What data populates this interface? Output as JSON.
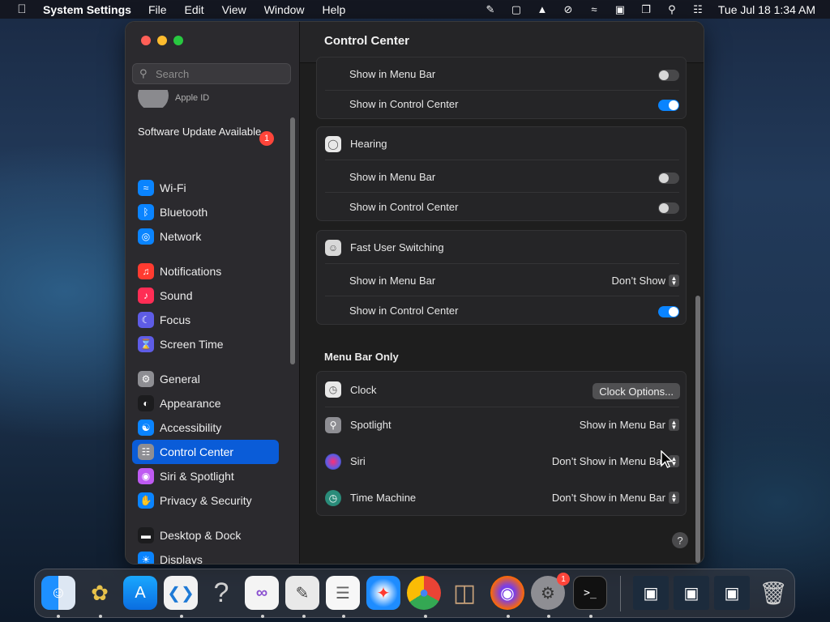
{
  "menubar": {
    "app_name": "System Settings",
    "items": [
      "File",
      "Edit",
      "View",
      "Window",
      "Help"
    ],
    "clock": "Tue Jul 18  1:34 AM"
  },
  "sidebar": {
    "search_placeholder": "Search",
    "apple_id_label": "Apple ID",
    "software_update": "Software Update Available",
    "software_update_badge": "1",
    "items": [
      {
        "label": "Wi-Fi",
        "icon": "wifi-icon",
        "color": "#0a84ff"
      },
      {
        "label": "Bluetooth",
        "icon": "bluetooth-icon",
        "color": "#0a84ff"
      },
      {
        "label": "Network",
        "icon": "globe-icon",
        "color": "#0a84ff"
      },
      {
        "label": "Notifications",
        "icon": "bell-icon",
        "color": "#ff3b30"
      },
      {
        "label": "Sound",
        "icon": "speaker-icon",
        "color": "#ff2d55"
      },
      {
        "label": "Focus",
        "icon": "moon-icon",
        "color": "#5e5ce6"
      },
      {
        "label": "Screen Time",
        "icon": "hourglass-icon",
        "color": "#5e5ce6"
      },
      {
        "label": "General",
        "icon": "gear-icon",
        "color": "#8e8e93"
      },
      {
        "label": "Appearance",
        "icon": "appearance-icon",
        "color": "#1c1c1e"
      },
      {
        "label": "Accessibility",
        "icon": "accessibility-icon",
        "color": "#0a84ff"
      },
      {
        "label": "Control Center",
        "icon": "control-center-icon",
        "color": "#8e8e93"
      },
      {
        "label": "Siri & Spotlight",
        "icon": "siri-icon",
        "color": "#bf5af2"
      },
      {
        "label": "Privacy & Security",
        "icon": "hand-icon",
        "color": "#0a84ff"
      },
      {
        "label": "Desktop & Dock",
        "icon": "dock-icon",
        "color": "#1c1c1e"
      },
      {
        "label": "Displays",
        "icon": "sun-icon",
        "color": "#0a84ff"
      }
    ],
    "selected": "Control Center"
  },
  "main": {
    "title": "Control Center",
    "top_group": {
      "rows": [
        {
          "label": "Show in Menu Bar",
          "on": false
        },
        {
          "label": "Show in Control Center",
          "on": true
        }
      ]
    },
    "hearing": {
      "title": "Hearing",
      "rows": [
        {
          "label": "Show in Menu Bar",
          "on": false
        },
        {
          "label": "Show in Control Center",
          "on": false
        }
      ]
    },
    "fast_user_switching": {
      "title": "Fast User Switching",
      "menu_bar_label": "Show in Menu Bar",
      "menu_bar_value": "Don’t Show",
      "control_center_label": "Show in Control Center",
      "control_center_on": true
    },
    "menu_bar_only": {
      "title": "Menu Bar Only",
      "clock": {
        "label": "Clock",
        "button": "Clock Options..."
      },
      "spotlight": {
        "label": "Spotlight",
        "value": "Show in Menu Bar"
      },
      "siri": {
        "label": "Siri",
        "value": "Don’t Show in Menu Bar"
      },
      "time_machine": {
        "label": "Time Machine",
        "value": "Don’t Show in Menu Bar"
      }
    },
    "help": "?"
  },
  "dock": {
    "settings_badge": "1"
  }
}
